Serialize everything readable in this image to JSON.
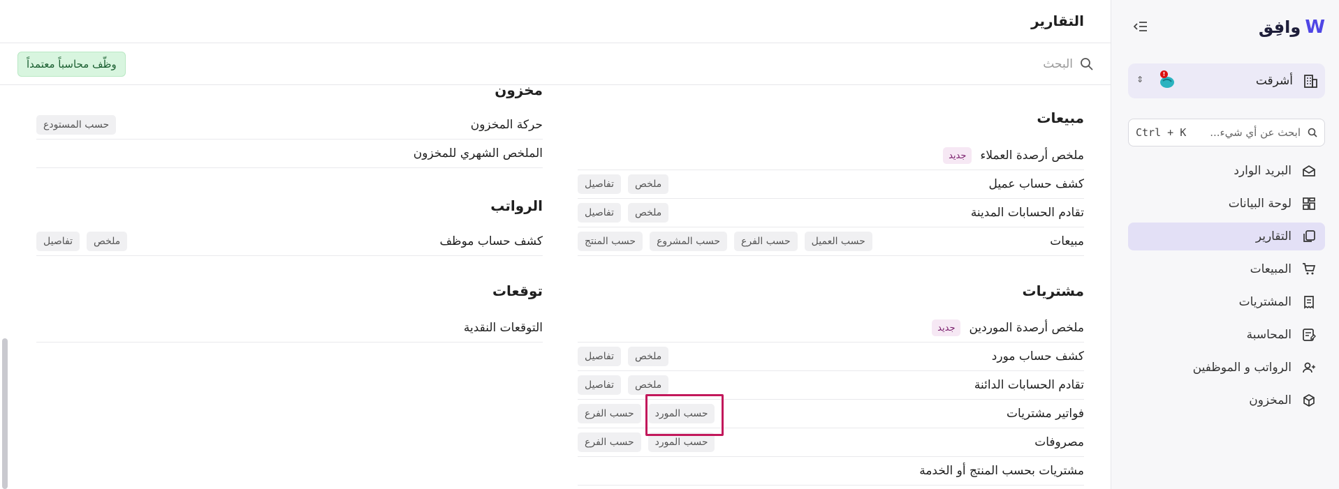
{
  "sidebar": {
    "brand": "وافِق",
    "org_name": "أشرقت",
    "search_placeholder": "ابحث عن أي شيء...",
    "search_shortcut": "Ctrl + K",
    "items": [
      {
        "label": "البريد الوارد",
        "icon": "inbox-icon"
      },
      {
        "label": "لوحة البيانات",
        "icon": "dashboard-icon"
      },
      {
        "label": "التقارير",
        "icon": "reports-icon",
        "active": true
      },
      {
        "label": "المبيعات",
        "icon": "cart-icon"
      },
      {
        "label": "المشتريات",
        "icon": "receipt-icon"
      },
      {
        "label": "المحاسبة",
        "icon": "ledger-icon"
      },
      {
        "label": "الرواتب و الموظفين",
        "icon": "users-icon"
      },
      {
        "label": "المخزون",
        "icon": "box-icon"
      }
    ]
  },
  "header": {
    "title": "التقارير",
    "search_placeholder": "البحث",
    "hire_button": "وظّف محاسباً معتمداً"
  },
  "sections": {
    "sales": {
      "title": "مبيعات",
      "rows": [
        {
          "label": "ملخص أرصدة العملاء",
          "badge": "جديد",
          "tags": []
        },
        {
          "label": "كشف حساب عميل",
          "tags": [
            "ملخص",
            "تفاصيل"
          ]
        },
        {
          "label": "تقادم الحسابات المدينة",
          "tags": [
            "ملخص",
            "تفاصيل"
          ]
        },
        {
          "label": "مبيعات",
          "tags": [
            "حسب العميل",
            "حسب الفرع",
            "حسب المشروع",
            "حسب المنتج"
          ]
        }
      ]
    },
    "purchases": {
      "title": "مشتريات",
      "rows": [
        {
          "label": "ملخص أرصدة الموردين",
          "badge": "جديد",
          "tags": []
        },
        {
          "label": "كشف حساب مورد",
          "tags": [
            "ملخص",
            "تفاصيل"
          ]
        },
        {
          "label": "تقادم الحسابات الدائنة",
          "tags": [
            "ملخص",
            "تفاصيل"
          ]
        },
        {
          "label": "فواتير مشتريات",
          "tags": [
            "حسب المورد",
            "حسب الفرع"
          ]
        },
        {
          "label": "مصروفات",
          "tags": [
            "حسب المورد",
            "حسب الفرع"
          ]
        },
        {
          "label": "مشتريات بحسب المنتج أو الخدمة",
          "tags": []
        }
      ]
    },
    "inventory": {
      "title": "مخزون",
      "rows": [
        {
          "label": "حركة المخزون",
          "tags": [
            "حسب المستودع"
          ]
        },
        {
          "label": "الملخص الشهري للمخزون",
          "tags": []
        }
      ]
    },
    "payroll": {
      "title": "الرواتب",
      "rows": [
        {
          "label": "كشف حساب موظف",
          "tags": [
            "ملخص",
            "تفاصيل"
          ]
        }
      ]
    },
    "forecasts": {
      "title": "توقعات",
      "rows": [
        {
          "label": "التوقعات النقدية",
          "tags": []
        }
      ]
    }
  }
}
